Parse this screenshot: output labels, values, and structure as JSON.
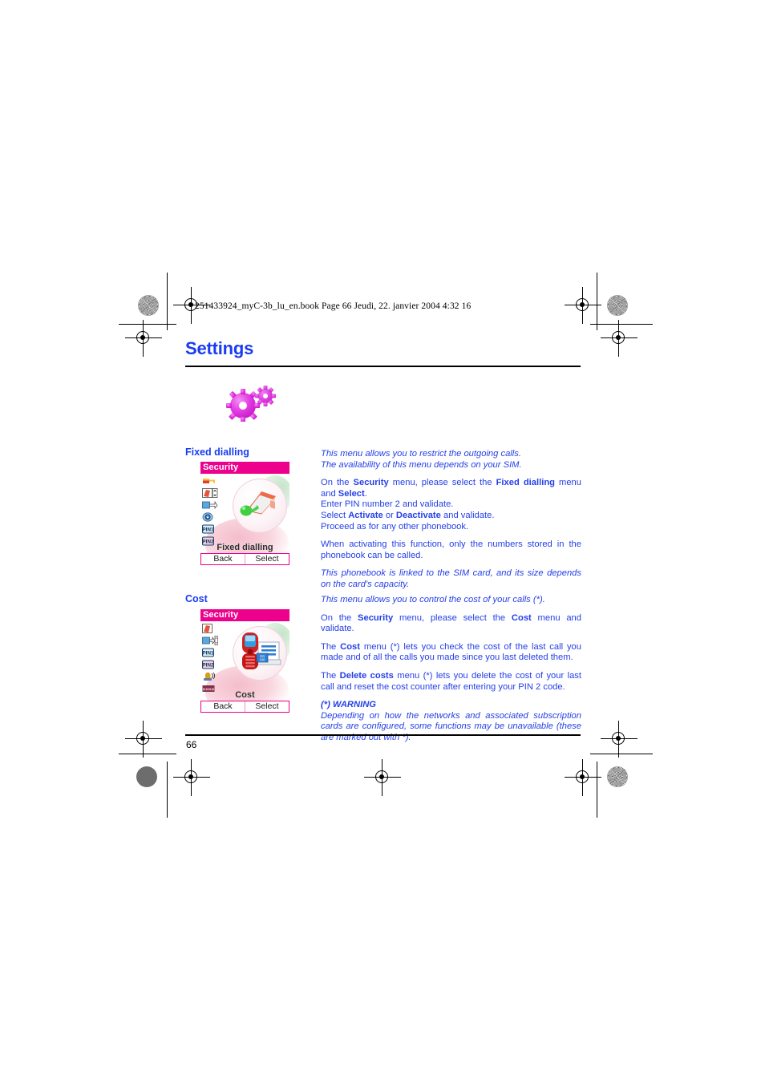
{
  "document": {
    "book_line": "251433924_myC-3b_lu_en.book  Page 66  Jeudi, 22. janvier 2004  4:32 16",
    "chapter_title": "Settings",
    "page_number": "66",
    "accent_blue": "#2540e8",
    "heading_blue": "#1a3cf0",
    "accent_magenta": "#ec008c",
    "chapter_icon": "gears-icon"
  },
  "sections": [
    {
      "heading": "Fixed dialling",
      "screenshot": {
        "title": "Security",
        "menu_label": "Fixed dialling",
        "softkeys": {
          "left": "Back",
          "right": "Select"
        },
        "icons": [
          "key-icon",
          "book-icon",
          "call-divert-icon",
          "download-icon",
          "pin1-icon",
          "pin2-icon"
        ]
      },
      "paragraphs": [
        {
          "style": "italic",
          "lines": [
            "This menu allows you to restrict the outgoing calls.",
            "The availability of this menu depends on your SIM."
          ]
        },
        {
          "style": "normal",
          "html": "On the <b>Security</b> menu, please select the <b>Fixed dialling</b> menu and <b>Select</b>."
        },
        {
          "style": "normal",
          "html": "Enter PIN number 2 and validate."
        },
        {
          "style": "normal",
          "html": "Select <b>Activate</b> or <b>Deactivate</b> and validate."
        },
        {
          "style": "normal",
          "html": "Proceed as for any other phonebook."
        },
        {
          "style": "normal",
          "html": "When activating this function, only the numbers stored in the phonebook can be called."
        },
        {
          "style": "italic",
          "html": "This phonebook is linked to the SIM card, and its size depends on the card's capacity."
        }
      ]
    },
    {
      "heading": "Cost",
      "screenshot": {
        "title": "Security",
        "menu_label": "Cost",
        "softkeys": {
          "left": "Back",
          "right": "Select"
        },
        "icons": [
          "book-icon",
          "call-divert-icon",
          "pin1-icon",
          "pin2-icon",
          "alarm-icon",
          "cost-icon"
        ]
      },
      "paragraphs": [
        {
          "style": "italic",
          "html": "This menu allows you to control the cost of your calls (*)."
        },
        {
          "style": "normal",
          "html": "On the <b>Security</b> menu, please select the <b>Cost</b> menu and validate."
        },
        {
          "style": "normal",
          "html": "The <b>Cost</b> menu (*) lets you check the cost of the last call you made and of all the calls you made since you last deleted them."
        },
        {
          "style": "normal",
          "html": "The <b>Delete costs</b> menu (*) lets you delete the cost of your last call and reset the cost counter after entering your PIN 2 code."
        },
        {
          "style": "bold-italic",
          "html": "(*) WARNING"
        },
        {
          "style": "italic",
          "html": "Depending on how the networks and associated subscription cards are configured, some functions may be unavailable (these are marked out with *)."
        }
      ]
    }
  ]
}
